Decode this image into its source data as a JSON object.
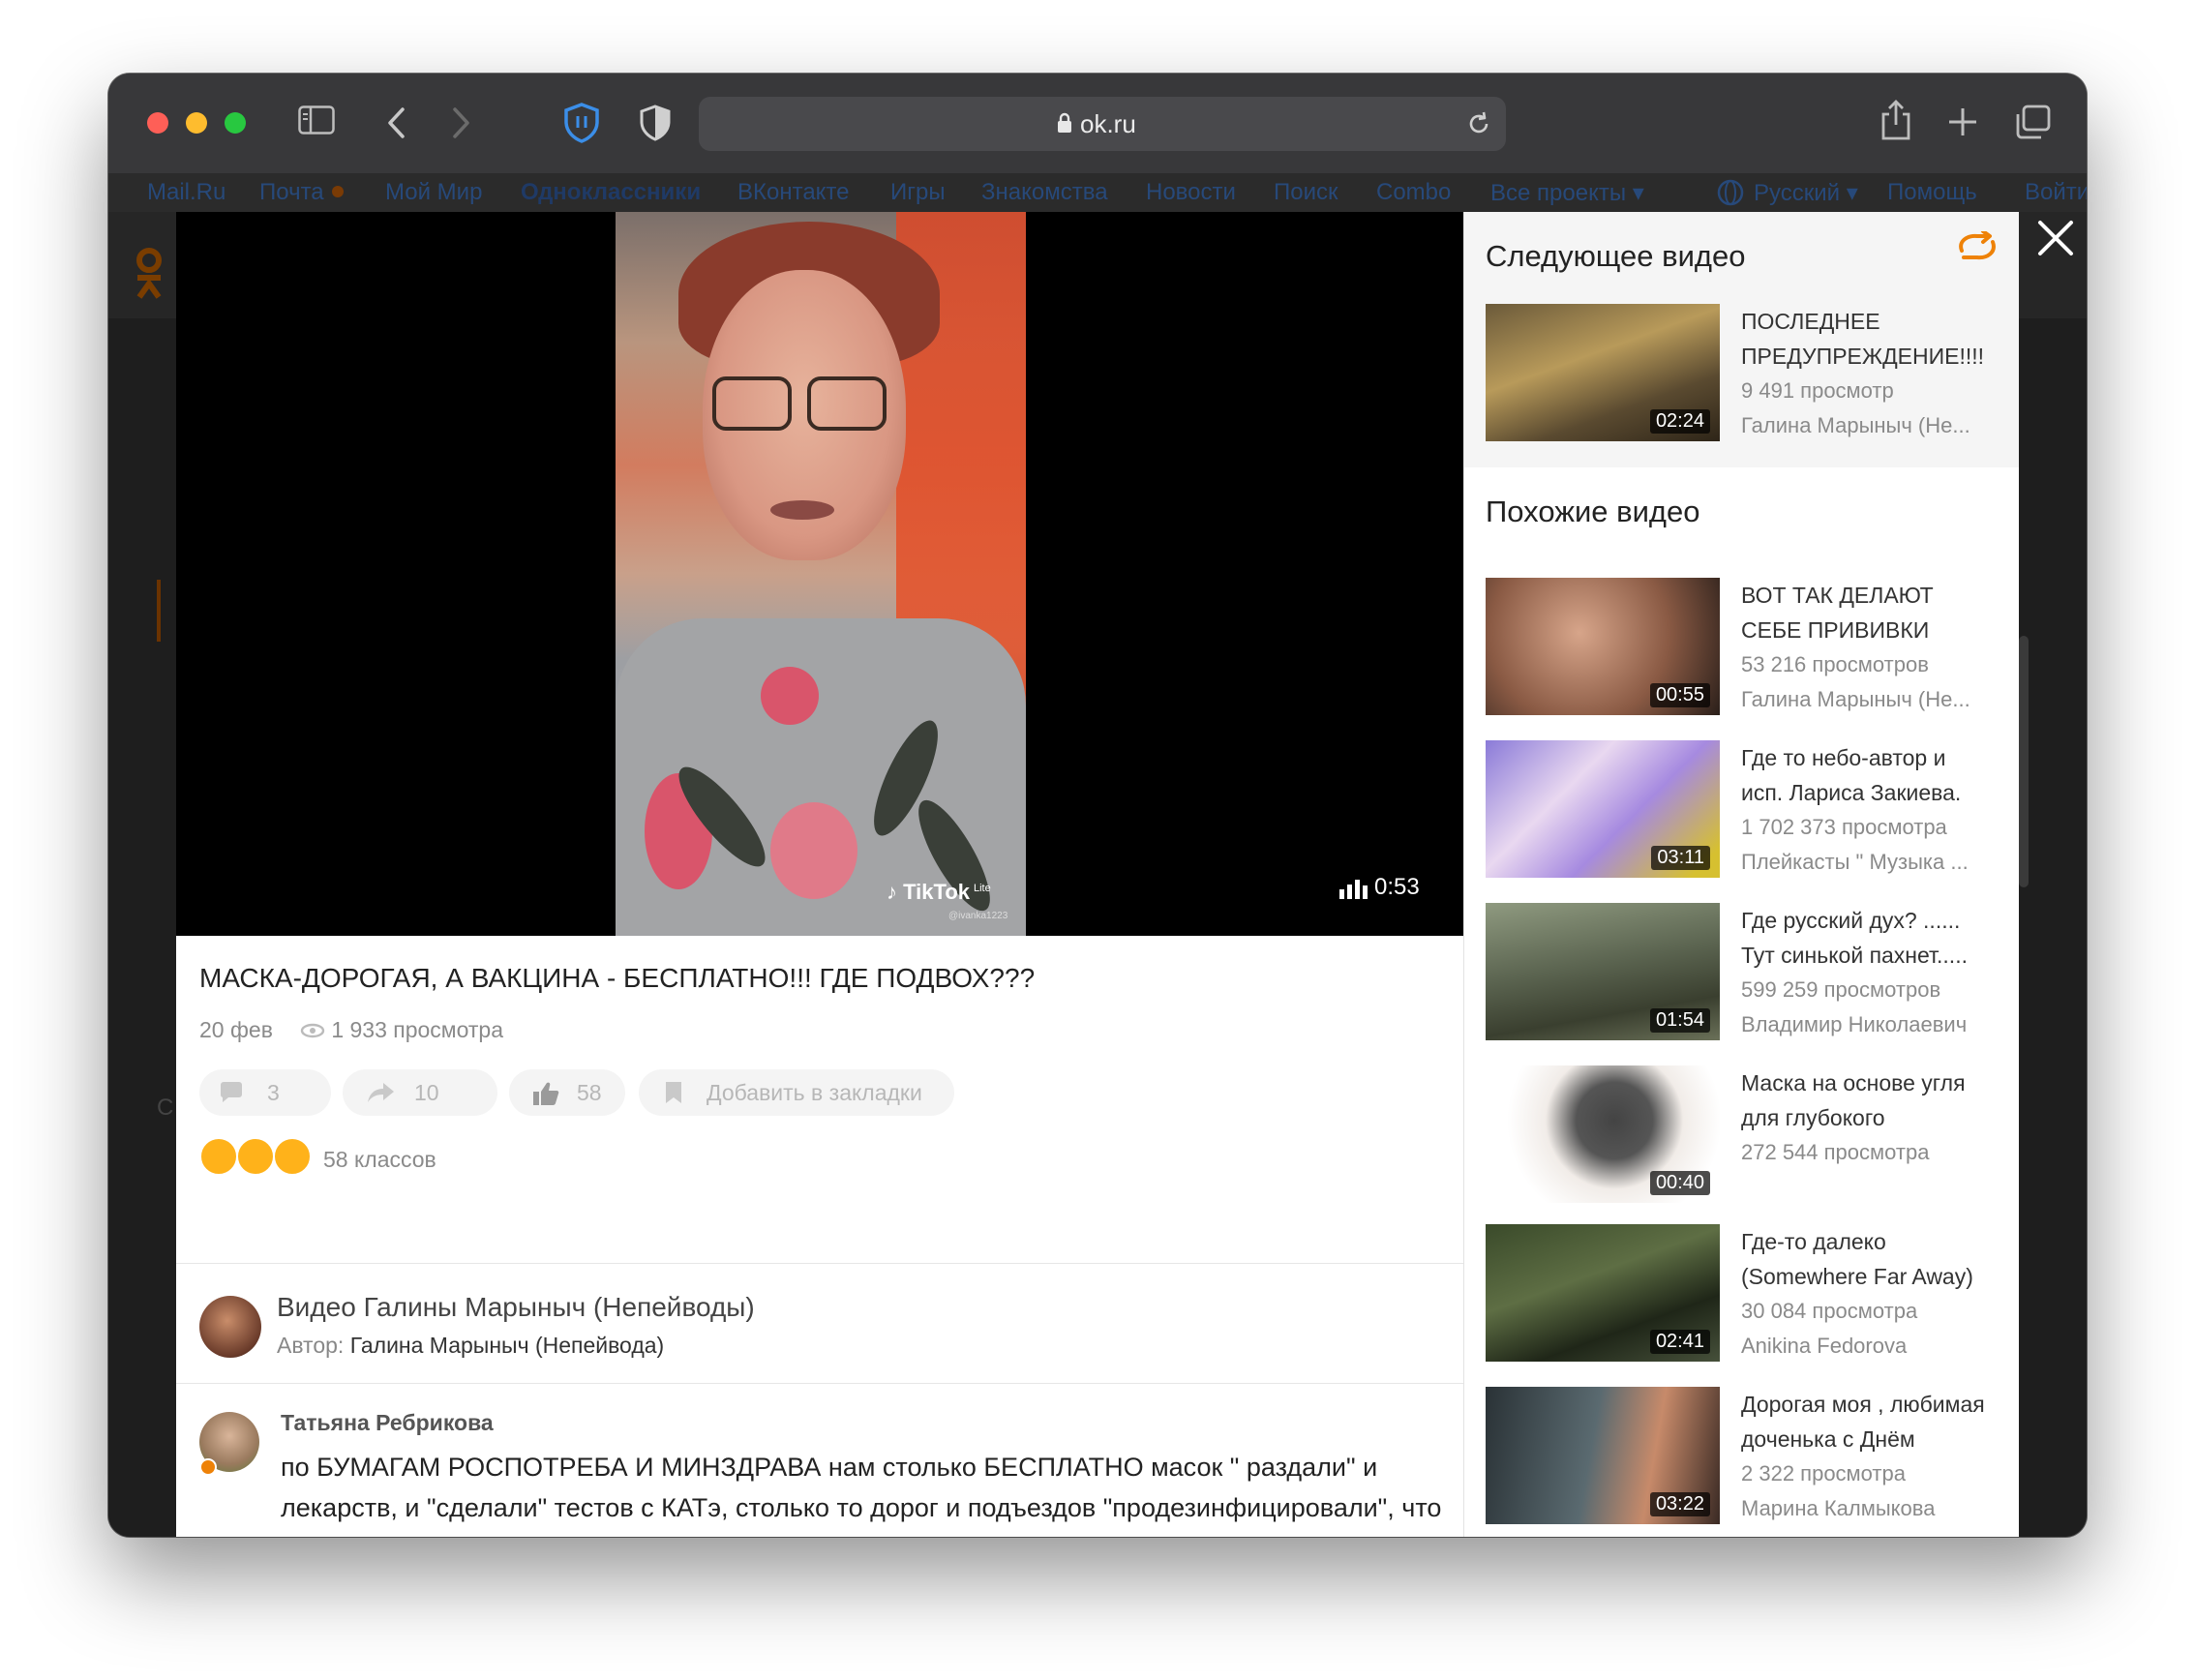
{
  "browser": {
    "url": "ok.ru",
    "icons": [
      "sidebar-icon",
      "back-icon",
      "forward-icon",
      "privacy-shield-icon",
      "contrast-shield-icon",
      "lock-icon",
      "reload-icon",
      "share-icon",
      "new-tab-icon",
      "tabs-overview-icon"
    ]
  },
  "portal_nav": {
    "items": [
      "Mail.Ru",
      "Почта",
      "Мой Мир",
      "Одноклассники",
      "ВКонтакте",
      "Игры",
      "Знакомства",
      "Новости",
      "Поиск",
      "Combo",
      "Все проекты ▾"
    ],
    "language": "Русский ▾",
    "help": "Помощь",
    "login": "Войти"
  },
  "bg_letter": "С",
  "video": {
    "title": "МАСКА-ДОРОГАЯ, А ВАКЦИНА - БЕСПЛАТНО!!! ГДЕ ПОДВОХ???",
    "date": "20 фев",
    "views": "1 933 просмотра",
    "duration": "0:53",
    "watermark": "TikTok",
    "watermark_sub": "Lite",
    "watermark_user": "@ivanka1223",
    "comments_count": "3",
    "shares_count": "10",
    "likes_count": "58",
    "bookmark_label": "Добавить в закладки",
    "classes_label": "58 классов"
  },
  "owner": {
    "name": "Видео Галины Марыныч (Непейводы)",
    "author_label": "Автор:",
    "author_name": "Галина Марыныч (Непейвода)"
  },
  "comment": {
    "author": "Татьяна Ребрикова",
    "text": "по БУМАГАМ РОСПОТРЕБА И МИНЗДРАВА нам столько БЕСПЛАТНО масок \" раздали\" и лекарств,  и \"сделали\" тестов с  КАТэ,  столько  то дорог и подъездов \"продезинфицировали\", что  если воочию увидеть  бы эти цифры- то прививки на их фоне ПРОСТО - ПШИК"
  },
  "sidebar": {
    "next_title": "Следующее видео",
    "similar_title": "Похожие видео",
    "next_video": {
      "line1": "ПОСЛЕДНЕЕ",
      "line2": "ПРЕДУПРЕЖДЕНИЕ!!!!",
      "views": "9 491 просмотр",
      "author": "Галина Марыныч (Не...",
      "duration": "02:24"
    },
    "similar": [
      {
        "line1": "ВОТ ТАК ДЕЛАЮТ",
        "line2": "СЕБЕ ПРИВИВКИ",
        "views": "53 216 просмотров",
        "author": "Галина Марыныч (Не...",
        "duration": "00:55"
      },
      {
        "line1": "Где то небо-автор и",
        "line2": "исп. Лариса Закиева.",
        "views": "1 702 373 просмотра",
        "author": "Плейкасты \" Музыка ...",
        "duration": "03:11"
      },
      {
        "line1": "Где русский дух? ......",
        "line2": "Тут синькой пахнет.....",
        "views": "599 259 просмотров",
        "author": "Владимир Николаевич",
        "duration": "01:54"
      },
      {
        "line1": "Маска на основе угля",
        "line2": "для глубокого",
        "views": "272 544 просмотра",
        "author": "",
        "duration": "00:40"
      },
      {
        "line1": "Где-то далеко",
        "line2": "(Somewhere Far Away)",
        "views": "30 084 просмотра",
        "author": "Anikina Fedorova",
        "duration": "02:41"
      },
      {
        "line1": "Дорогая моя , любимая",
        "line2": "доченька с Днём",
        "views": "2 322 просмотра",
        "author": "Марина Калмыкова",
        "duration": "03:22"
      }
    ]
  },
  "colors": {
    "accent": "#ee8208",
    "close": "#ffffff"
  }
}
